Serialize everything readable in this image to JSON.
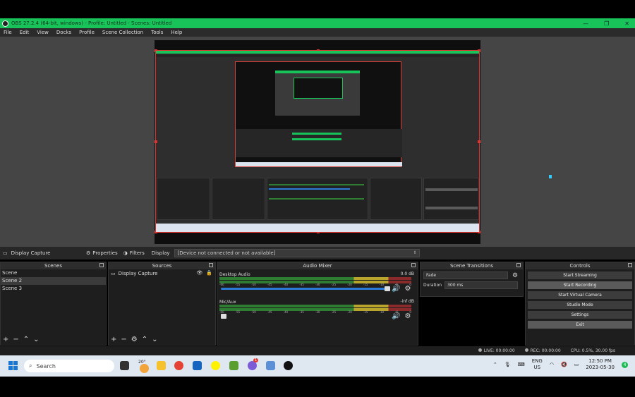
{
  "window": {
    "title": "OBS 27.2.4 (64-bit, windows) - Profile: Untitled - Scenes: Untitled",
    "controls": [
      "—",
      "❐",
      "✕"
    ]
  },
  "menu": [
    "File",
    "Edit",
    "View",
    "Docks",
    "Profile",
    "Scene Collection",
    "Tools",
    "Help"
  ],
  "source_toolbar": {
    "source_name": "Display Capture",
    "properties_label": "Properties",
    "filters_label": "Filters",
    "display_label": "Display",
    "display_value": "[Device not connected or not available]"
  },
  "scenes": {
    "title": "Scenes",
    "items": [
      "Scene",
      "Scene 2",
      "Scene 3"
    ],
    "selected_index": 1
  },
  "sources": {
    "title": "Sources",
    "items": [
      "Display Capture"
    ]
  },
  "mixer": {
    "title": "Audio Mixer",
    "ticks": [
      "-60",
      "-55",
      "-50",
      "-45",
      "-40",
      "-35",
      "-30",
      "-25",
      "-20",
      "-15",
      "-10",
      "-5",
      "0"
    ],
    "channels": [
      {
        "name": "Desktop Audio",
        "db": "0.0 dB",
        "volume": 1.0
      },
      {
        "name": "Mic/Aux",
        "db": "-inf dB",
        "volume": 0.0
      }
    ]
  },
  "transitions": {
    "title": "Scene Transitions",
    "type": "Fade",
    "duration_label": "Duration",
    "duration_value": "300 ms"
  },
  "controls": {
    "title": "Controls",
    "buttons": [
      "Start Streaming",
      "Start Recording",
      "Start Virtual Camera",
      "Studio Mode",
      "Settings",
      "Exit"
    ],
    "highlighted": [
      1,
      5
    ]
  },
  "status": {
    "live": "LIVE: 00:00:00",
    "rec": "REC: 00:00:00",
    "cpu": "CPU: 0.5%, 30.00 fps"
  },
  "taskbar": {
    "search_placeholder": "Search",
    "weather_temp": "20°",
    "lang_line1": "ENG",
    "lang_line2": "US",
    "time": "12:50 PM",
    "date": "2023-05-30",
    "notification_count": "4",
    "app_badge": "1"
  },
  "colors": {
    "title_bar": "#18c35a",
    "selection_border": "#e0322e",
    "volume_bar": "#2a7bd8"
  }
}
